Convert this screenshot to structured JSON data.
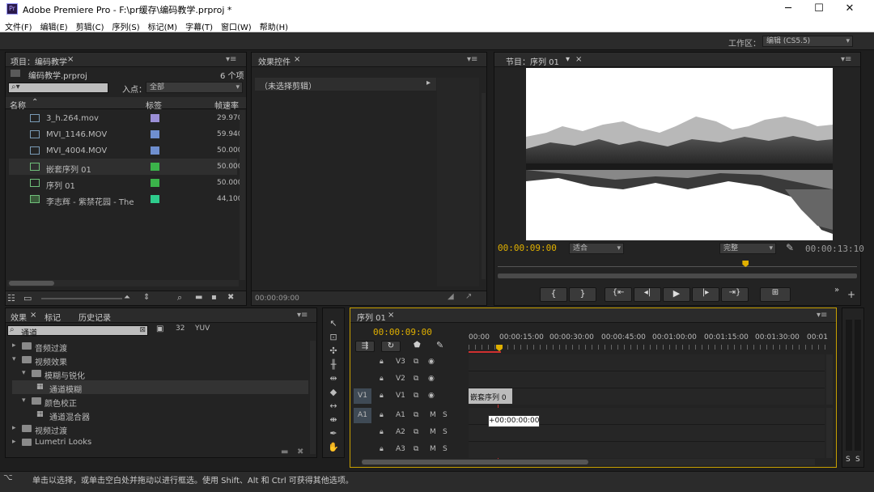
{
  "window": {
    "title": "Adobe Premiere Pro - F:\\pr缓存\\编码教学.prproj *",
    "app_icon": "Pr",
    "controls": [
      "─",
      "☐",
      "✕"
    ]
  },
  "menu": [
    "文件(F)",
    "编辑(E)",
    "剪辑(C)",
    "序列(S)",
    "标记(M)",
    "字幕(T)",
    "窗口(W)",
    "帮助(H)"
  ],
  "workspace": {
    "label": "工作区：",
    "value": "编辑 (CS5.5)"
  },
  "project": {
    "tab": "项目：编码教学",
    "file": "编码教学.prproj",
    "count": "6 个项",
    "search_placeholder": "",
    "in_label": "入点：",
    "in_value": "全部",
    "columns": {
      "name": "名称",
      "label": "标签",
      "fps": "帧速率"
    },
    "items": [
      {
        "name": "3_h.264.mov",
        "fps": "29.970",
        "color": "#9b8fd6",
        "icon": "video-file-icon"
      },
      {
        "name": "MVI_1146.MOV",
        "fps": "59.940",
        "color": "#6f8fcf",
        "icon": "av-file-icon"
      },
      {
        "name": "MVI_4004.MOV",
        "fps": "50.000",
        "color": "#6f8fcf",
        "icon": "av-file-icon"
      },
      {
        "name": "嵌套序列 01",
        "fps": "50.000",
        "color": "#3bb34a",
        "icon": "sequence-icon"
      },
      {
        "name": "序列 01",
        "fps": "50.000",
        "color": "#3bb34a",
        "icon": "sequence-icon"
      },
      {
        "name": "李志辉 - 紫禁花园 - The",
        "fps": "44,100",
        "color": "#2ecc8c",
        "icon": "audio-file-icon"
      }
    ]
  },
  "effect_controls": {
    "tab": "效果控件",
    "no_clip": "（未选择剪辑）",
    "timecode": "00:00:09:00"
  },
  "program": {
    "tab": "节目：序列 01",
    "timecode": "00:00:09:00",
    "fit": "适合",
    "quality": "完整",
    "duration": "00:00:13:10",
    "playhead": 0.69
  },
  "effects": {
    "tabs": [
      "效果",
      "标记",
      "历史记录"
    ],
    "search": "通道",
    "tree": [
      {
        "text": "音频过渡",
        "level": 0,
        "open": false
      },
      {
        "text": "视频效果",
        "level": 0,
        "open": true
      },
      {
        "text": "模糊与锐化",
        "level": 1,
        "open": true
      },
      {
        "text": "通道模糊",
        "level": 2,
        "item": true,
        "selected": true
      },
      {
        "text": "颜色校正",
        "level": 1,
        "open": true
      },
      {
        "text": "通道混合器",
        "level": 2,
        "item": true
      },
      {
        "text": "视频过渡",
        "level": 0,
        "open": false
      },
      {
        "text": "Lumetri Looks",
        "level": 0,
        "open": false
      }
    ]
  },
  "timeline": {
    "tab": "序列 01",
    "timecode": "00:00:09:00",
    "ruler": [
      "00:00",
      "00:00:15:00",
      "00:00:30:00",
      "00:00:45:00",
      "00:01:00:00",
      "00:01:15:00",
      "00:01:30:00",
      "00:01"
    ],
    "video_tracks": [
      "V3",
      "V2",
      "V1"
    ],
    "audio_tracks": [
      "A1",
      "A2",
      "A3"
    ],
    "src_v": "V1",
    "src_a": "A1",
    "clip": "嵌套序列 0",
    "tooltip": "+00:00:00:00"
  },
  "status": "单击以选择，或单击空白处并拖动以进行框选。使用 Shift、Alt 和 Ctrl 可获得其他选项。",
  "meter": {
    "labels": [
      "S",
      "S"
    ]
  }
}
